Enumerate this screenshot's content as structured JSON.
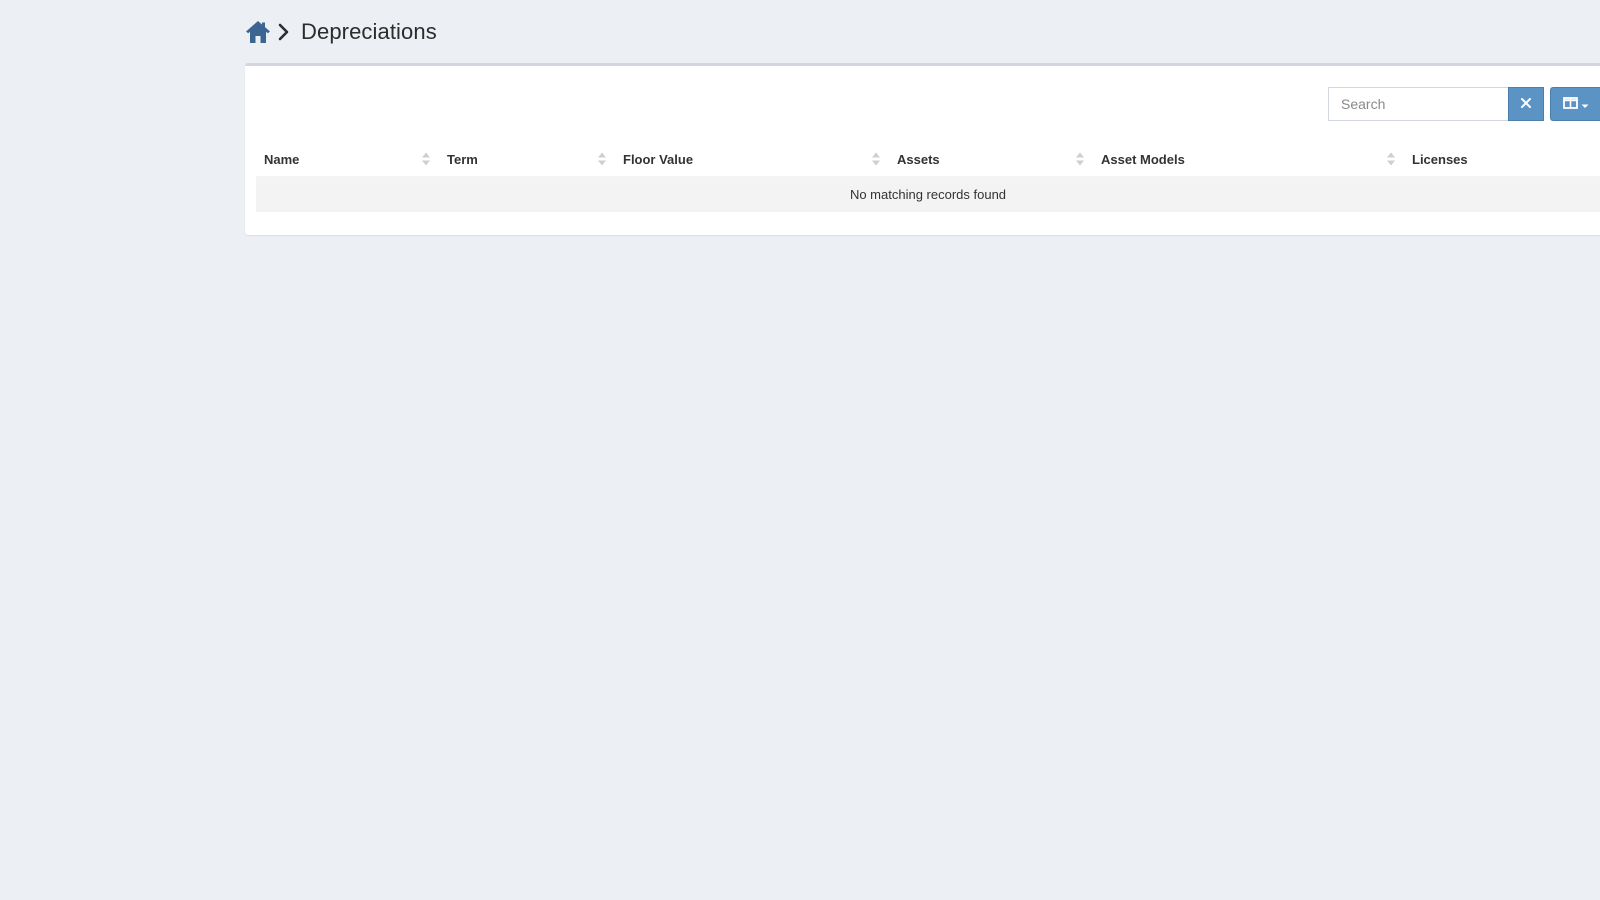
{
  "breadcrumb": {
    "home_icon": "home-icon",
    "separator_icon": "chevron-right-icon",
    "title": "Depreciations"
  },
  "toolbar": {
    "search_placeholder": "Search",
    "clear_icon": "close-icon",
    "columns_icon": "columns-icon"
  },
  "table": {
    "columns": [
      {
        "label": "Name"
      },
      {
        "label": "Term"
      },
      {
        "label": "Floor Value"
      },
      {
        "label": "Assets"
      },
      {
        "label": "Asset Models"
      },
      {
        "label": "Licenses"
      }
    ],
    "empty_message": "No matching records found"
  },
  "colors": {
    "page_background": "#ecf0f5",
    "accent": "#5b93c4",
    "home_icon": "#3c6591"
  }
}
